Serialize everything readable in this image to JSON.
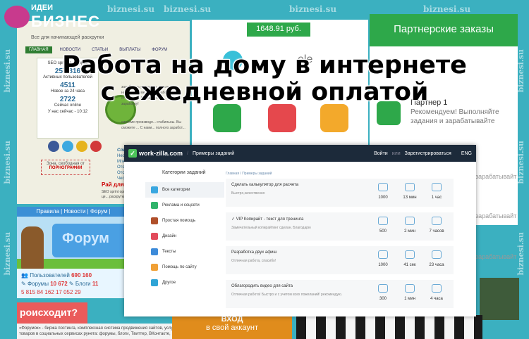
{
  "logo": {
    "ideas": "ИДЕИ",
    "biz": "БИЗНЕС"
  },
  "watermark": "biznesi.su",
  "headline": {
    "line1": "Работа на дому в интернете",
    "line2": "с ежедневной оплатой"
  },
  "old_site": {
    "tagline": "Все для начинающей раскрутки",
    "nav": [
      "ГЛАВНАЯ",
      "НОВОСТИ",
      "СТАТЬИ",
      "ВЫПЛАТЫ",
      "ФОРУМ"
    ],
    "stats_title": "SEO sprint в цифрах",
    "stats": [
      {
        "value": "257 816",
        "label": "Активных пользователей"
      },
      {
        "value": "4511",
        "label": "Новое за 24 часа"
      },
      {
        "value": "2722",
        "label": "Сейчас online"
      }
    ],
    "online_now": "У нас сейчас - 10:12",
    "banner_line1": "Зона, свободная от",
    "banner_line2": "ПОРНОГРАФИИ",
    "text": "заработать реальные деньги ... нескольких методов заработ... стабильны. Вы сможете т... выбор заработку!",
    "text2": "системе производя... стабильны. Вы сможете ... С нами... полного заработ...",
    "spec_title": "Специаль...",
    "spec_items": [
      "Нескол...",
      "Мгнове...",
      "Отсутст...",
      "Отсутс...",
      "Честны..."
    ],
    "rai": "Рай для р...",
    "seo_sprint": "SEO sprint организа... Для этих це... раскрутки. ..."
  },
  "forum": {
    "nav": "Правила | Новости | Форум |",
    "banner_text": "Форум",
    "users_label": "Пользователей",
    "users": "690 160",
    "forums_label": "Форумы",
    "forums": "10 672",
    "blogs_label": "Блоги",
    "blogs": "11",
    "bottom_counts": [
      "5 815",
      "84 162",
      "17 052",
      "29"
    ]
  },
  "occurs": "роисходит?",
  "old_bottom": "«Форумок» - биржа постинга, комплексная система продвижения сайтов, услуг и товаров в социальных сервисах рунета: форумы, блоги, Твиттер, ВКонтакте,",
  "app": {
    "balance": "1648.91 руб."
  },
  "partners": {
    "title": "Партнерские заказы",
    "partner": "Партнер 1",
    "partner_text": "Рекомендуем! Выполняйте задания и зарабатывайте",
    "earn": "зарабатывайт",
    "partner_snippet": "ele"
  },
  "vxod": {
    "line1": "ВХОД",
    "line2": "в свой аккаунт"
  },
  "workzilla": {
    "logo": "work-zilla.com",
    "section": "Примеры заданий",
    "login": "Войти",
    "or": "или",
    "register": "Зарегистрироваться",
    "lang": "ENG",
    "categories_title": "Категории заданий",
    "categories": [
      {
        "label": "Все категории",
        "color": "#3aa7e0"
      },
      {
        "label": "Реклама и соцсети",
        "color": "#2fb36a"
      },
      {
        "label": "Простая помощь",
        "color": "#b0502b"
      },
      {
        "label": "Дизайн",
        "color": "#e24a5b"
      },
      {
        "label": "Тексты",
        "color": "#3d8bd9"
      },
      {
        "label": "Помощь по сайту",
        "color": "#f0a035"
      },
      {
        "label": "Другое",
        "color": "#2fa4d6"
      }
    ],
    "crumb": "Главная  /  Примеры заданий",
    "tasks": [
      {
        "title": "Сделать калькулятор для расчета",
        "subtitle": "Быстро,качественно",
        "price": "1000",
        "time": "13 мин",
        "deadline": "1 час"
      },
      {
        "title": "✓ VIP Копирайт - текст для тренинга",
        "subtitle": "Замечательный копирайтинг сделан. Благодарю",
        "price": "500",
        "time": "2 мин",
        "deadline": "7 часов"
      },
      {
        "title": "Разработка двух афиш",
        "subtitle": "Отличная работа, спасибо!",
        "price": "1000",
        "time": "41 сек",
        "deadline": "23 часа"
      },
      {
        "title": "Облагородить видео для сайта",
        "subtitle": "Отличная работа! Быстро и с учетом всех пожеланий! рекомендую.",
        "price": "300",
        "time": "1 мин",
        "deadline": "4 часа"
      }
    ]
  }
}
